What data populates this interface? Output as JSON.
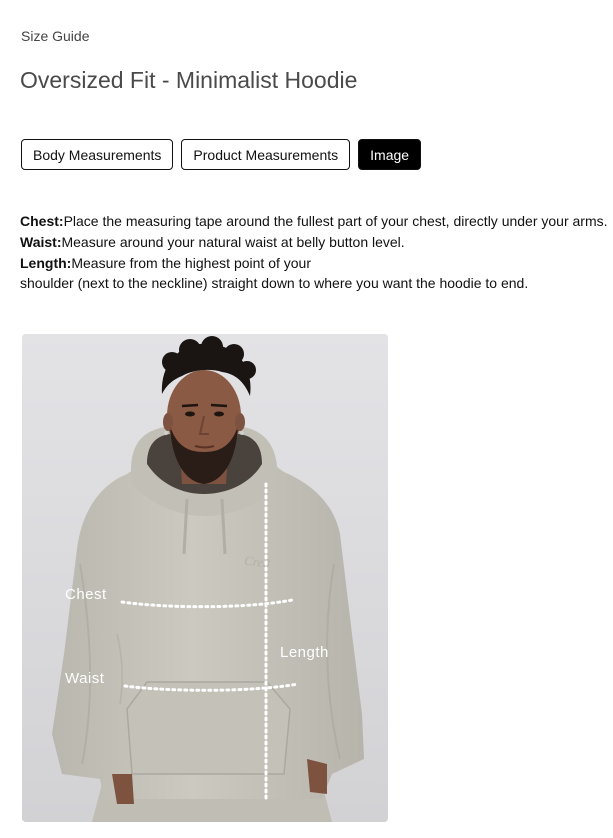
{
  "breadcrumb": "Size Guide",
  "title": "Oversized Fit - Minimalist Hoodie",
  "tabs": [
    {
      "label": "Body Measurements",
      "active": false
    },
    {
      "label": "Product Measurements",
      "active": false
    },
    {
      "label": "Image",
      "active": true
    }
  ],
  "instructions": {
    "chest": {
      "label": "Chest:",
      "text": "Place the measuring tape around the fullest part of your chest, directly under your arms."
    },
    "waist": {
      "label": "Waist:",
      "text": "Measure around your natural waist at belly button level."
    },
    "length": {
      "label": "Length:",
      "text_line1": "Measure from the highest point of your",
      "text_line2": "shoulder (next to the neckline) straight down to where you want the hoodie to end."
    }
  },
  "image": {
    "labels": {
      "chest": "Chest",
      "waist": "Waist",
      "length": "Length"
    },
    "colors": {
      "background": "#dcdcdf",
      "hoodie": "#c6c4bb",
      "hoodie_shadow": "#aeaca3",
      "skin": "#8a5a44",
      "hair": "#1a1412",
      "measure_line": "#ffffff"
    }
  }
}
